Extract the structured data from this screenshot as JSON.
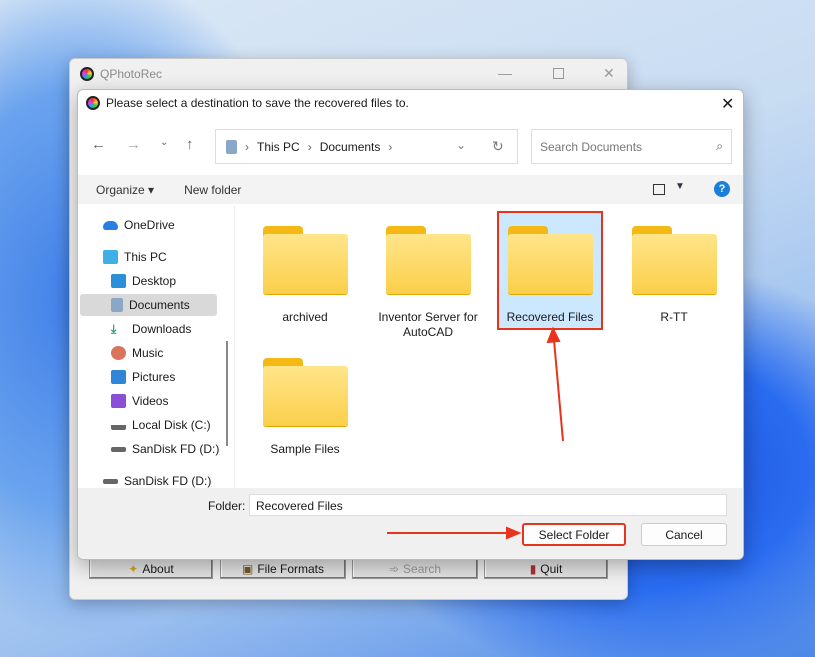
{
  "app": {
    "title": "QPhotoRec",
    "buttons": [
      {
        "label": "About",
        "icon": "star-icon"
      },
      {
        "label": "File Formats",
        "icon": "file-formats-icon"
      },
      {
        "label": "Search",
        "icon": "search-arrow-icon"
      },
      {
        "label": "Quit",
        "icon": "exit-door-icon"
      }
    ]
  },
  "dialog": {
    "title": "Please select a destination to save the recovered files to.",
    "breadcrumb": [
      "This PC",
      "Documents"
    ],
    "search_placeholder": "Search Documents",
    "toolbar": {
      "organize": "Organize",
      "new_folder": "New folder"
    },
    "sidebar": [
      {
        "label": "OneDrive",
        "icon": "onedrive-icon"
      },
      {
        "label": "This PC",
        "icon": "pc-icon"
      },
      {
        "label": "Desktop",
        "icon": "desktop-icon"
      },
      {
        "label": "Documents",
        "icon": "documents-icon",
        "selected": true
      },
      {
        "label": "Downloads",
        "icon": "downloads-icon"
      },
      {
        "label": "Music",
        "icon": "music-icon"
      },
      {
        "label": "Pictures",
        "icon": "pictures-icon"
      },
      {
        "label": "Videos",
        "icon": "videos-icon"
      },
      {
        "label": "Local Disk (C:)",
        "icon": "drive-icon"
      },
      {
        "label": "SanDisk FD (D:)",
        "icon": "usb-drive-icon"
      },
      {
        "label": "SanDisk FD (D:)",
        "icon": "usb-drive-icon"
      }
    ],
    "folders": [
      {
        "name": "archived"
      },
      {
        "name": "Inventor Server for AutoCAD"
      },
      {
        "name": "Recovered Files",
        "selected": true
      },
      {
        "name": "R-TT"
      },
      {
        "name": "Sample Files"
      }
    ],
    "folder_label": "Folder:",
    "folder_value": "Recovered Files",
    "select_button": "Select Folder",
    "cancel_button": "Cancel"
  },
  "colors": {
    "accent": "#0067c0",
    "highlight": "#cce8ff",
    "annotation": "#e8341c"
  }
}
